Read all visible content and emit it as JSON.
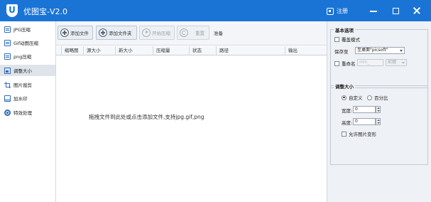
{
  "app": {
    "title": "优图宝-V2.0",
    "logo_letter": "U",
    "register_label": "注册",
    "accent_color": "#1a74d6"
  },
  "sidebar": {
    "items": [
      {
        "label": "JPG压缩",
        "icon": "document-icon",
        "active": false
      },
      {
        "label": "Gif动图压缩",
        "icon": "document-icon",
        "active": false
      },
      {
        "label": "png压缩",
        "icon": "document-icon",
        "active": false
      },
      {
        "label": "调整大小",
        "icon": "resize-icon",
        "active": true
      },
      {
        "label": "图片裁剪",
        "icon": "crop-icon",
        "active": false
      },
      {
        "label": "加水印",
        "icon": "watermark-icon",
        "active": false
      },
      {
        "label": "特效处理",
        "icon": "effect-icon",
        "active": false
      }
    ]
  },
  "toolbar": {
    "add_file": "添加文件",
    "add_folder": "添加文件夹",
    "start_compress": "开始压缩",
    "reset": "重置",
    "status": "准备"
  },
  "table": {
    "columns": [
      "缩略图",
      "源大小",
      "新大小",
      "压缩量",
      "状态",
      "路径",
      "输出"
    ],
    "rows": [],
    "empty_hint": "拖拽文件到此处或点击添加文件,支持jpg.gif,png"
  },
  "basic_options": {
    "title": "基本选项",
    "overwrite_label": "覆盖模式",
    "save_to_label": "保存至",
    "save_to_value": "至桌面\"picsoft\"",
    "rename_label": "重命名",
    "rename_prefix": "min_",
    "rename_position": "前缀"
  },
  "resize_options": {
    "title": "调整大小",
    "mode_custom": "自定义",
    "mode_percent": "百分比",
    "mode_selected": "custom",
    "width_label": "宽度:",
    "width_value": "0",
    "height_label": "高度:",
    "height_value": "0",
    "allow_distort_label": "允许图片变形"
  }
}
